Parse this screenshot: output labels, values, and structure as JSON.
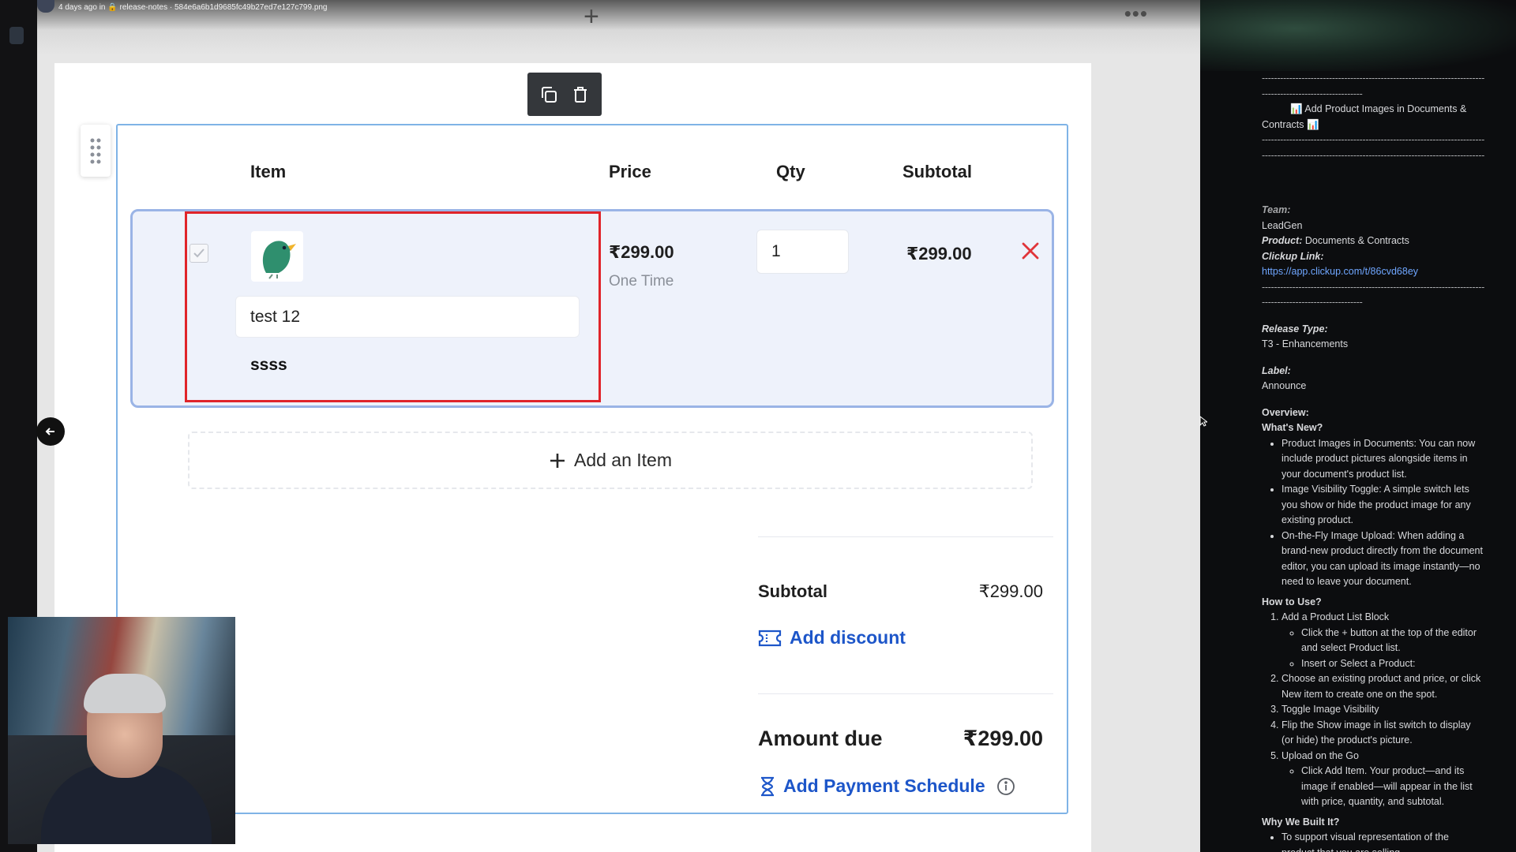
{
  "topbar": {
    "meta": "4 days ago in 🔒 release-notes · 584e6a6b1d9685fc49b27ed7e127c799.png",
    "add_symbol": "+",
    "more_symbol": "•••"
  },
  "toolbar": {
    "copy_icon": "copy-icon",
    "delete_icon": "trash-icon"
  },
  "table": {
    "headers": {
      "item": "Item",
      "price": "Price",
      "qty": "Qty",
      "subtotal": "Subtotal"
    },
    "rows": [
      {
        "checked": true,
        "name": "test 12",
        "description": "ssss",
        "price": "₹299.00",
        "billing": "One Time",
        "qty": "1",
        "subtotal": "₹299.00"
      }
    ]
  },
  "add_item_label": "Add an Item",
  "summary": {
    "subtotal_label": "Subtotal",
    "subtotal_value": "₹299.00",
    "add_discount_label": "Add discount",
    "amount_due_label": "Amount due",
    "amount_due_value": "₹299.00",
    "payment_schedule_label": "Add Payment Schedule"
  },
  "colors": {
    "accent_link": "#1d56c9",
    "highlight_box": "#e0242a",
    "row_border": "#9ab4e6",
    "remove": "#e0353a"
  },
  "notes": {
    "rule": "------------------------------------------------------------------------------------",
    "rule_short": "---------------------------------",
    "headline": "Add Product Images in Documents & Contracts",
    "team_label": "Team:",
    "team_value": "LeadGen",
    "product_label": "Product:",
    "product_value": "Documents & Contracts",
    "clickup_label": "Clickup Link:",
    "clickup_url": "https://app.clickup.com/t/86cvd68ey",
    "release_type_label": "Release Type:",
    "release_type_value": "T3 - Enhancements",
    "label_label": "Label:",
    "label_value": "Announce",
    "overview": "Overview:",
    "whats_new": "What's New?",
    "whats_new_items": [
      "Product Images in Documents: You can now include product pictures alongside items in your document's product list.",
      "Image Visibility Toggle: A simple switch lets you show or hide the product image for any existing product.",
      "On-the-Fly Image Upload: When adding a brand-new product directly from the document editor, you can upload its image instantly—no need to leave your document."
    ],
    "how_to": "How to Use?",
    "steps": [
      {
        "text": "Add a Product List Block",
        "sub": [
          "Click the + button at the top of the editor and select Product list.",
          "Insert or Select a Product:"
        ]
      },
      {
        "text": "Choose an existing product and price, or click New item to create one on the spot.",
        "sub": []
      },
      {
        "text": "Toggle Image Visibility",
        "sub": []
      },
      {
        "text": "Flip the Show image in list switch to display (or hide) the product's picture.",
        "sub": []
      },
      {
        "text": "Upload on the Go",
        "sub": [
          "Click Add Item. Your product—and its image if enabled—will appear in the list with price, quantity, and subtotal."
        ]
      }
    ],
    "why": "Why We Built It?",
    "why_items": [
      "To support visual representation of the product that you are selling"
    ]
  }
}
